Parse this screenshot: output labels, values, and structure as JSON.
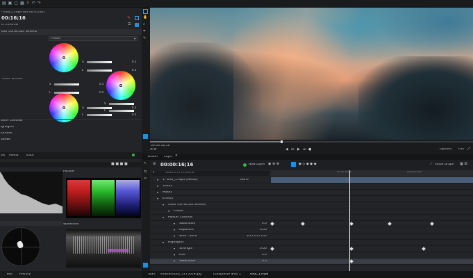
{
  "app": {
    "toolbar_icons": [
      "layout-icon",
      "new-icon",
      "open-icon",
      "save-icon",
      "export-icon",
      "undo-icon",
      "redo-icon"
    ]
  },
  "left": {
    "clip_name": "- shot_1.mp4 [00:00:45;00]",
    "timecode": "00:16;16",
    "effect_controls_label": "ct Controls",
    "effect_title": "olor Correction Wheels",
    "preset": "Preset",
    "wheels_label": "Color Wheels",
    "wheel_rows": [
      {
        "label": "S",
        "value": "0.5"
      },
      {
        "label": "L",
        "value": "0.5"
      },
      {
        "label": "S",
        "value": "0.5"
      },
      {
        "label": "L",
        "value": "0.5"
      },
      {
        "label": "S",
        "value": "0.5"
      },
      {
        "label": "S",
        "value": "0.5"
      },
      {
        "label": "L",
        "value": "0.5"
      },
      {
        "label": "L",
        "value": "0.5"
      }
    ],
    "sections": [
      "aster Controls",
      "ighlights",
      "idtones",
      "adows"
    ],
    "tabs": [
      "ols",
      "Media",
      "Track"
    ],
    "scope_tabs": [
      "Parade",
      "Waveform"
    ],
    "bottom_tabs": [
      "Text",
      "History"
    ]
  },
  "viewer": {
    "timecode": "00:00:16;16",
    "options": "Options",
    "zoom": "Full",
    "tabs": [
      "Viewer",
      "Layer"
    ]
  },
  "timeline": {
    "timecode": "00:00:16;16",
    "new_layer": "New Layer",
    "value_graph": "Value Graph",
    "search_placeholder": "Search in Timeline",
    "ruler": [
      "00:00:16;00",
      "00:00:20;00"
    ],
    "rows": [
      {
        "label": "1. shot_1.mp4 [Media]",
        "extra": "None",
        "indent": 1
      },
      {
        "label": "Tracks",
        "indent": 1
      },
      {
        "label": "Masks",
        "indent": 1
      },
      {
        "label": "Effects",
        "indent": 1
      },
      {
        "label": "Color Correction Wheels",
        "indent": 2
      },
      {
        "label": "Preset",
        "indent": 3
      },
      {
        "label": "Master Controls",
        "indent": 2
      },
      {
        "label": "Saturation",
        "value": "0.0",
        "indent": 4
      },
      {
        "label": "Exposure",
        "value": "0.00",
        "indent": 4
      },
      {
        "label": "Whit...ance",
        "value": "255   255   255",
        "indent": 4
      },
      {
        "label": "Highlights",
        "indent": 2
      },
      {
        "label": "Strength",
        "value": "0.00",
        "indent": 4
      },
      {
        "label": "Hue",
        "value": "0.0",
        "indent": 4
      },
      {
        "label": "Saturation",
        "value": "0.5",
        "indent": 4
      }
    ],
    "bottom_tabs": [
      "Start",
      "shutterstock_5175059.jpg",
      "Composite Shot 1",
      "shot_1.mp4"
    ]
  }
}
